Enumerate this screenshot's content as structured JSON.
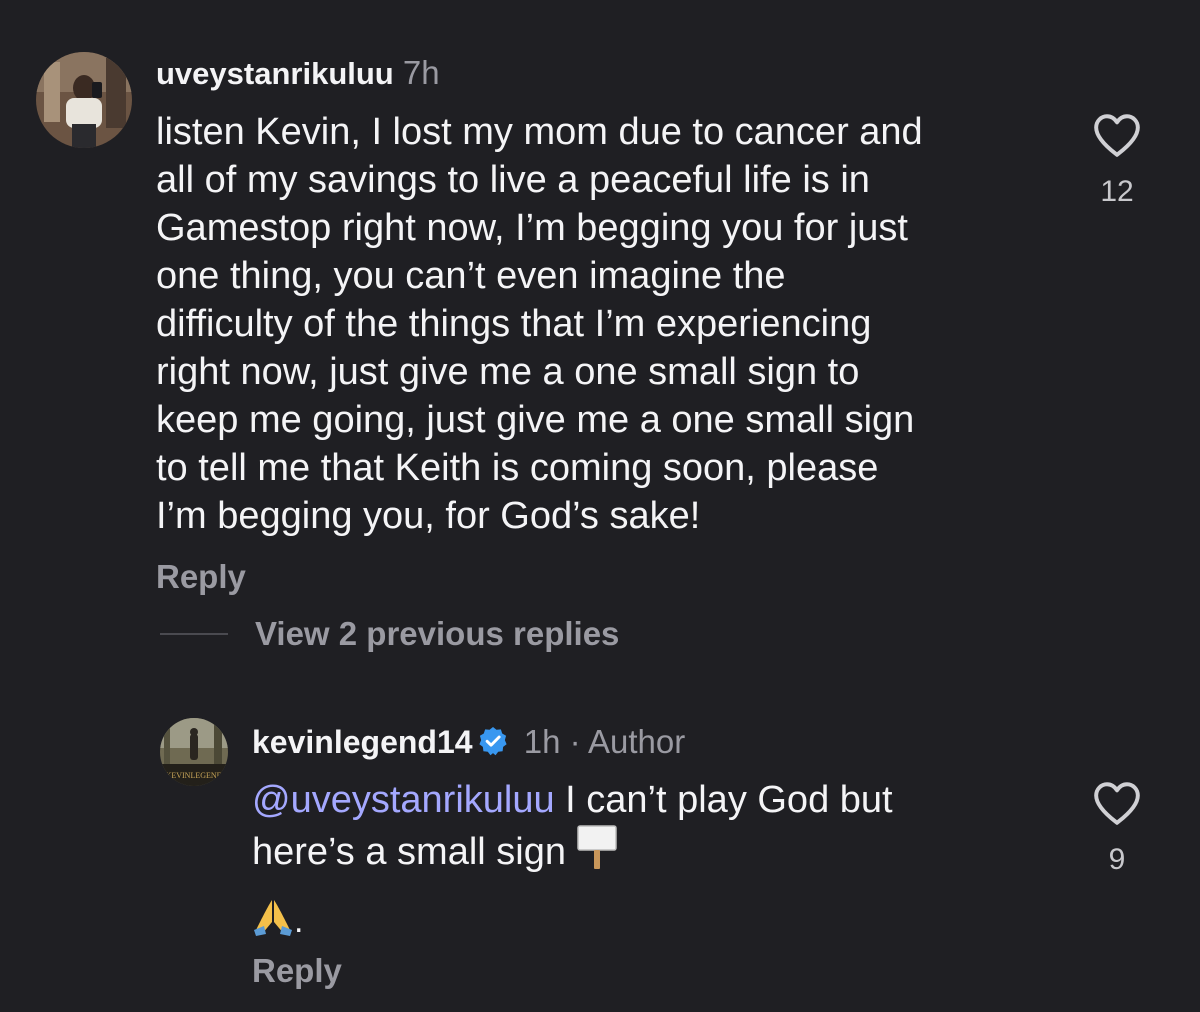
{
  "comments": [
    {
      "username": "uveystanrikuluu",
      "time": "7h",
      "text_lines": [
        "listen Kevin, I lost my mom due to cancer and",
        "all of my savings to live a peaceful life is in",
        "Gamestop right now, I’m begging you for just",
        "one thing, you can’t even imagine the",
        "difficulty of the things that I’m experiencing",
        "right now, just give me a one small sign to",
        "keep me going, just give me a one small sign",
        "to tell me that Keith is coming soon, please",
        "I’m begging you, for God’s sake!"
      ],
      "likes": "12",
      "reply_label": "Reply"
    }
  ],
  "thread": {
    "view_replies_label": "View 2 previous replies"
  },
  "reply": {
    "username": "kevinlegend14",
    "verified": true,
    "time": "1h",
    "separator": "·",
    "badge": "Author",
    "mention": "@uveystanrikuluu",
    "text_line1": " I can’t play God but",
    "text_line2": "here’s a small sign",
    "emoji_suffix": ".",
    "likes": "9",
    "reply_label": "Reply"
  },
  "icons": {
    "like": "heart-outline-icon",
    "verified": "verified-badge-icon",
    "sign": "placard-emoji",
    "pray": "folded-hands-emoji"
  },
  "colors": {
    "background": "#1f1f23",
    "text": "#f4f4f6",
    "muted": "#9a9aa2",
    "mention": "#a4a8ff",
    "verified": "#3897f0"
  }
}
